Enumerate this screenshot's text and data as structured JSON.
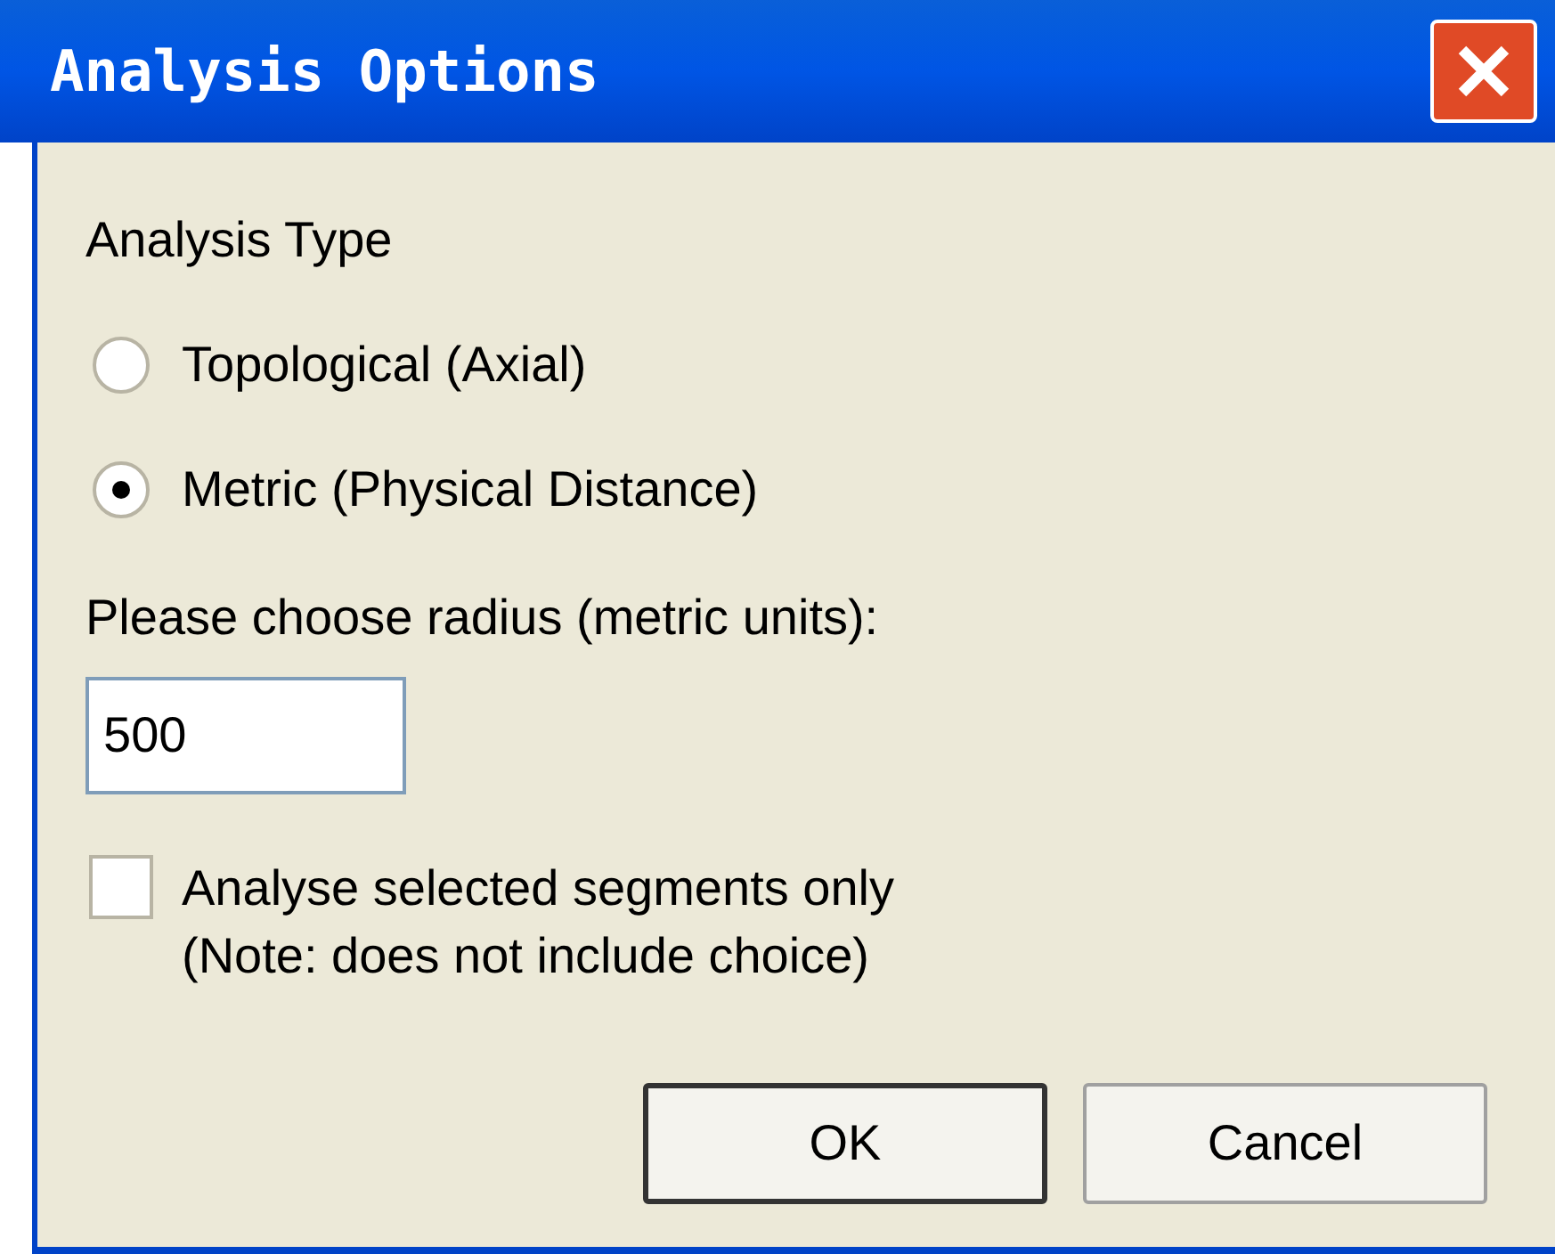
{
  "window": {
    "title": "Analysis Options"
  },
  "analysis_type": {
    "label": "Analysis Type",
    "options": [
      {
        "label": "Topological (Axial)",
        "selected": false
      },
      {
        "label": "Metric (Physical Distance)",
        "selected": true
      }
    ]
  },
  "radius": {
    "label": "Please choose radius (metric units):",
    "value": "500"
  },
  "selected_only": {
    "label": "Analyse selected segments only",
    "note": "(Note: does not include choice)",
    "checked": false
  },
  "buttons": [
    {
      "label": "OK",
      "default": true
    },
    {
      "label": "Cancel",
      "default": false
    }
  ]
}
